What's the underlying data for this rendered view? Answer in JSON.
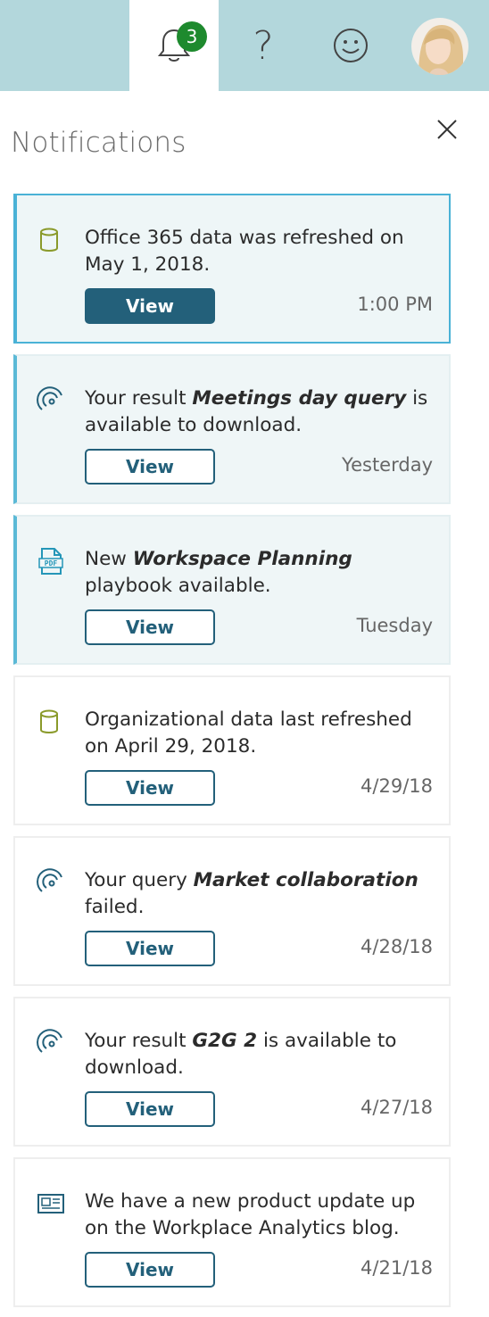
{
  "header": {
    "notification_count": "3",
    "help_glyph": "?",
    "icons": [
      "bell-icon",
      "help-icon",
      "smiley-icon",
      "avatar"
    ]
  },
  "panel": {
    "title": "Notifications",
    "close_icon": "close-icon"
  },
  "notifications": [
    {
      "icon": "database-icon",
      "before": "Office 365 data was refreshed on May 1, 2018.",
      "emph": "",
      "after": "",
      "button": "View",
      "time": "1:00 PM",
      "state": "selected"
    },
    {
      "icon": "query-result-icon",
      "before": "Your result ",
      "emph": "Meetings day query",
      "after": " is available to download.",
      "button": "View",
      "time": "Yesterday",
      "state": "unread"
    },
    {
      "icon": "pdf-icon",
      "before": "New ",
      "emph": "Workspace Planning",
      "after": " playbook available.",
      "button": "View",
      "time": "Tuesday",
      "state": "unread"
    },
    {
      "icon": "database-icon",
      "before": "Organizational data last refreshed on April 29, 2018.",
      "emph": "",
      "after": "",
      "button": "View",
      "time": "4/29/18",
      "state": "read"
    },
    {
      "icon": "query-result-icon",
      "before": "Your query ",
      "emph": "Market collaboration",
      "after": " failed.",
      "button": "View",
      "time": "4/28/18",
      "state": "read"
    },
    {
      "icon": "query-result-icon",
      "before": "Your result ",
      "emph": "G2G 2",
      "after": " is available to download.",
      "button": "View",
      "time": "4/27/18",
      "state": "read"
    },
    {
      "icon": "news-icon",
      "before": "We have a new product update up on the Workplace Analytics blog.",
      "emph": "",
      "after": "",
      "button": "View",
      "time": "4/21/18",
      "state": "read"
    }
  ],
  "colors": {
    "topbar": "#b3d7dc",
    "badge": "#1e8a2e",
    "accent": "#23607a",
    "unread_border": "#5bb9d6",
    "database_icon": "#8a9a2a"
  }
}
